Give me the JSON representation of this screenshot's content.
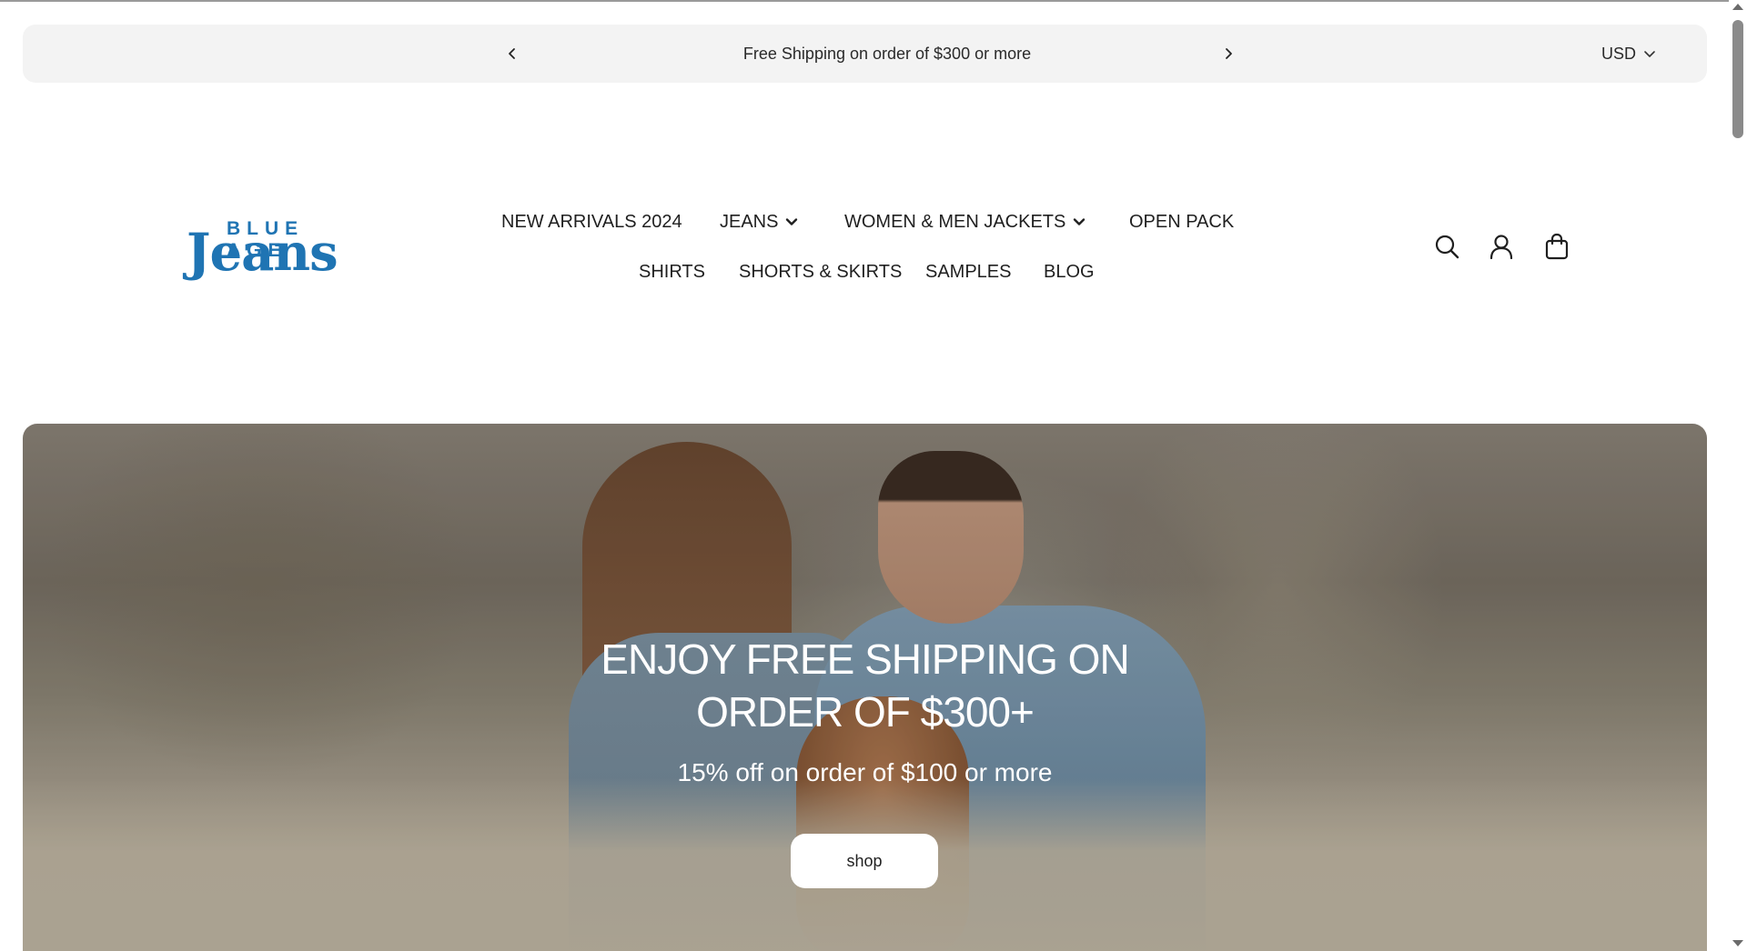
{
  "announcement": {
    "message": "Free Shipping on order of $300 or more",
    "prev_icon": "chevron-left-icon",
    "next_icon": "chevron-right-icon"
  },
  "currency": {
    "selected": "USD",
    "icon": "chevron-down-icon"
  },
  "logo": {
    "top_text": "BLUE AGE",
    "main_text": "Jeans",
    "color": "#1f74b3"
  },
  "nav": {
    "row1": [
      {
        "label": "NEW ARRIVALS 2024",
        "has_dropdown": false
      },
      {
        "label": "JEANS",
        "has_dropdown": true
      },
      {
        "label": "WOMEN & MEN JACKETS",
        "has_dropdown": true
      },
      {
        "label": "OPEN PACK",
        "has_dropdown": false
      }
    ],
    "row2": [
      {
        "label": "SHIRTS"
      },
      {
        "label": "SHORTS & SKIRTS"
      },
      {
        "label": "SAMPLES"
      },
      {
        "label": "BLOG"
      }
    ]
  },
  "header_icons": [
    "search-icon",
    "account-icon",
    "cart-bag-icon"
  ],
  "hero": {
    "title_line1": "ENJOY FREE SHIPPING ON",
    "title_line2": "ORDER OF $300+",
    "subtitle": "15% off on order of $100 or more",
    "button_label": "shop"
  }
}
